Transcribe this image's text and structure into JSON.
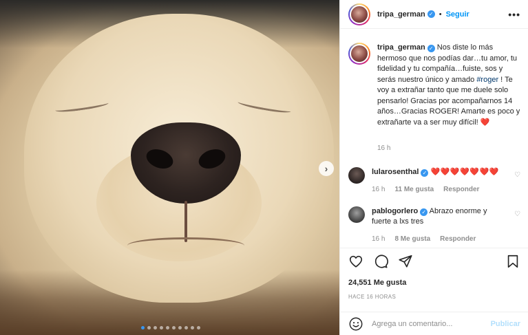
{
  "post": {
    "image_index": 1,
    "image_count": 10
  },
  "header": {
    "username": "tripa_german",
    "separator": "•",
    "follow_label": "Seguir",
    "more_label": "•••"
  },
  "caption": {
    "username": "tripa_german",
    "text_before_hashtag": " Nos diste lo más hermoso que nos podías dar…tu amor, tu fidelidad y tu compañía…fuiste, sos y serás nuestro único y amado ",
    "hashtag": "#roger",
    "text_after_hashtag": " ! Te voy a extrañar tanto que me duele solo pensarlo! Gracias por acompañarnos 14 años…Gracias ROGER! Amarte es poco y extrañarte va a ser muy difícil! ",
    "heart": "❤️",
    "time": "16 h"
  },
  "comments": [
    {
      "username": "lularosenthal",
      "text": "❤️❤️❤️❤️❤️❤️❤️",
      "time": "16 h",
      "likes": "11 Me gusta",
      "reply_label": "Responder"
    },
    {
      "username": "pablogorlero",
      "text": " Abrazo enorme y fuerte a lxs tres",
      "time": "16 h",
      "likes": "8 Me gusta",
      "reply_label": "Responder"
    }
  ],
  "actions": {
    "likes_count": "24,551 Me gusta",
    "posted_ago": "HACE 16 HORAS"
  },
  "comment_box": {
    "placeholder": "Agrega un comentario...",
    "publish_label": "Publicar"
  },
  "colors": {
    "accent": "#0095f6",
    "verified": "#3897f0",
    "heart": "#ed4956",
    "muted": "#8e8e8e"
  },
  "icons": {
    "like": "heart-outline-icon",
    "comment": "speech-bubble-icon",
    "share": "paper-plane-icon",
    "save": "bookmark-icon",
    "emoji": "smiley-face-icon",
    "next": "chevron-right-icon"
  }
}
